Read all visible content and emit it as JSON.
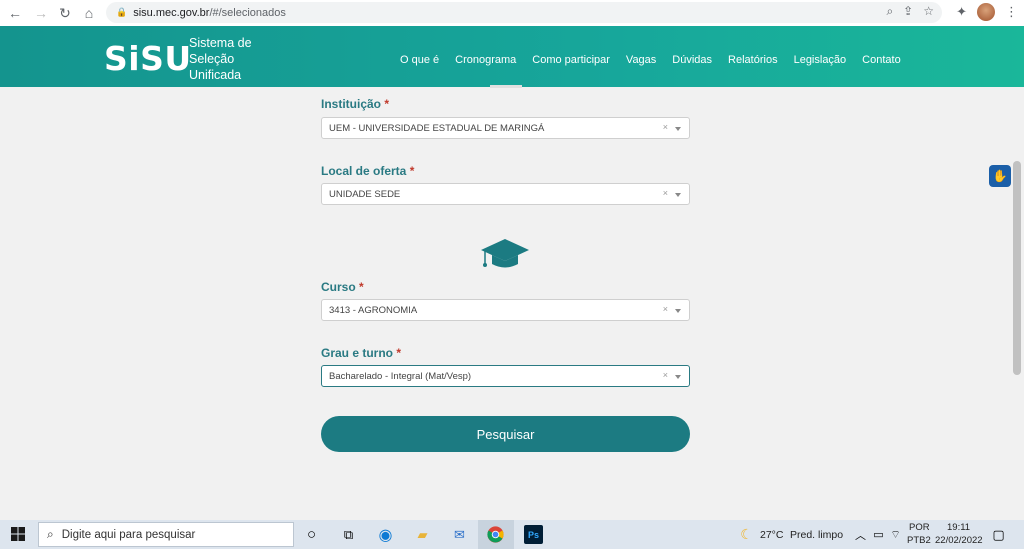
{
  "browser": {
    "url_host": "sisu.mec.gov.br",
    "url_path": "/#/selecionados"
  },
  "header": {
    "logo": "SiSU",
    "subtitle_lines": [
      "Sistema de",
      "Seleção",
      "Unificada"
    ],
    "menu": [
      "O que é",
      "Cronograma",
      "Como participar",
      "Vagas",
      "Dúvidas",
      "Relatórios",
      "Legislação",
      "Contato"
    ]
  },
  "form": {
    "instituicao": {
      "label": "Instituição",
      "required": "*",
      "value": "UEM - UNIVERSIDADE ESTADUAL DE MARINGÁ"
    },
    "local": {
      "label": "Local de oferta",
      "required": "*",
      "value": "UNIDADE SEDE"
    },
    "curso": {
      "label": "Curso",
      "required": "*",
      "value": "3413 - AGRONOMIA"
    },
    "grau": {
      "label": "Grau e turno",
      "required": "*",
      "value": "Bacharelado - Integral (Mat/Vesp)"
    },
    "clear_symbol": "×",
    "submit": "Pesquisar"
  },
  "taskbar": {
    "search_placeholder": "Digite aqui para pesquisar",
    "weather_temp": "27°C",
    "weather_desc": "Pred. limpo",
    "lang": "POR",
    "layout": "PTB2",
    "time": "19:11",
    "date": "22/02/2022"
  },
  "colors": {
    "header_start": "#14948e",
    "header_end": "#1ab79a",
    "accent": "#1c7b82",
    "required": "#c0392b"
  }
}
